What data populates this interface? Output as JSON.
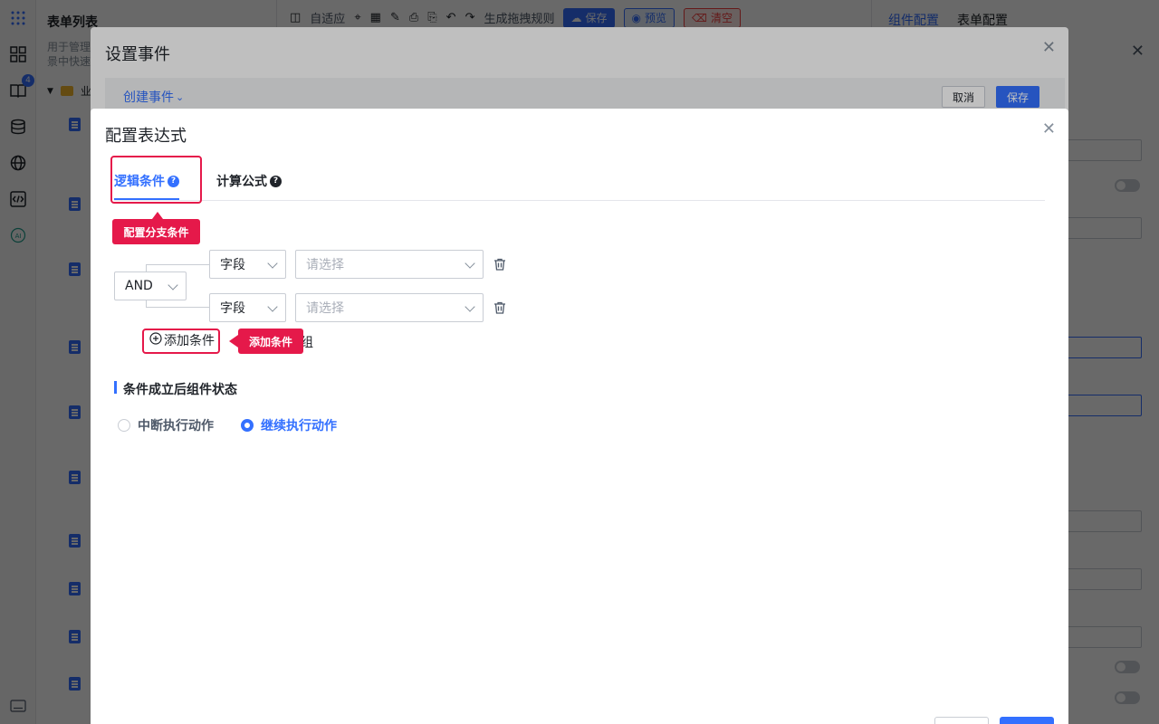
{
  "background": {
    "form_list": {
      "title": "表单列表",
      "description": "用于管理\n景中快速",
      "folder_label": "业"
    },
    "left_bar": {
      "badge": "4"
    },
    "toolbar": {
      "adaptive": "自适应",
      "drag_rule": "生成拖拽规则",
      "save": "保存",
      "preview": "预览",
      "clear": "清空"
    },
    "right_panel": {
      "tab_component": "组件配置",
      "tab_form": "表单配置"
    }
  },
  "event_modal": {
    "title": "设置事件",
    "create_event": "创建事件",
    "cancel": "取消",
    "save": "保存"
  },
  "expr_modal": {
    "title": "配置表达式",
    "tabs": {
      "logic": "逻辑条件",
      "formula": "计算公式"
    },
    "logic_operator": "AND",
    "conditions": [
      {
        "field": "字段",
        "value_placeholder": "请选择"
      },
      {
        "field": "字段",
        "value_placeholder": "请选择"
      }
    ],
    "add_condition": "添加条件",
    "add_group_tail": "组",
    "section_title": "条件成立后组件状态",
    "radios": {
      "interrupt": "中断执行动作",
      "continue": "继续执行动作",
      "selected": "continue"
    }
  },
  "annotations": {
    "branch_callout": "配置分支条件",
    "add_callout": "添加条件"
  },
  "colors": {
    "accent": "#3370ff",
    "highlight": "#e5194a"
  }
}
